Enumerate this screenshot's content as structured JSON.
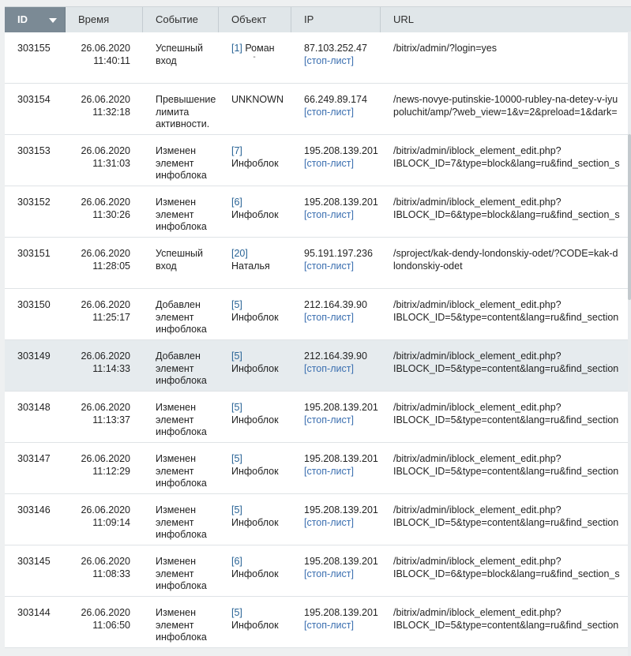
{
  "columns": {
    "id": "ID",
    "time": "Время",
    "event": "Событие",
    "object": "Объект",
    "ip": "IP",
    "url": "URL"
  },
  "sort": {
    "column": "id",
    "direction": "desc"
  },
  "stoplist_label": "[стоп-лист]",
  "rows": [
    {
      "id": "303155",
      "date": "26.06.2020",
      "time": "11:40:11",
      "event": "Успешный вход",
      "object_link": "[1]",
      "object_text": "Роман",
      "object_extra": "-",
      "ip": "87.103.252.47",
      "url1": "/bitrix/admin/?login=yes",
      "url2": ""
    },
    {
      "id": "303154",
      "date": "26.06.2020",
      "time": "11:32:18",
      "event": "Превышение лимита активности.",
      "object_link": "",
      "object_text": "UNKNOWN",
      "ip": "66.249.89.174",
      "url1": "/news-novye-putinskie-10000-rubley-na-detey-v-iyu",
      "url2": "poluchit/amp/?web_view=1&v=2&preload=1&dark="
    },
    {
      "id": "303153",
      "date": "26.06.2020",
      "time": "11:31:03",
      "event": "Изменен элемент инфоблока",
      "object_link": "[7]",
      "object_text": "Инфоблок",
      "ip": "195.208.139.201",
      "url1": "/bitrix/admin/iblock_element_edit.php?",
      "url2": "IBLOCK_ID=7&type=block&lang=ru&find_section_s"
    },
    {
      "id": "303152",
      "date": "26.06.2020",
      "time": "11:30:26",
      "event": "Изменен элемент инфоблока",
      "object_link": "[6]",
      "object_text": "Инфоблок",
      "ip": "195.208.139.201",
      "url1": "/bitrix/admin/iblock_element_edit.php?",
      "url2": "IBLOCK_ID=6&type=block&lang=ru&find_section_s"
    },
    {
      "id": "303151",
      "date": "26.06.2020",
      "time": "11:28:05",
      "event": "Успешный вход",
      "object_link": "[20]",
      "object_text": "Наталья",
      "ip": "95.191.197.236",
      "url1": "/sproject/kak-dendy-londonskiy-odet/?CODE=kak-d",
      "url2": "londonskiy-odet"
    },
    {
      "id": "303150",
      "date": "26.06.2020",
      "time": "11:25:17",
      "event": "Добавлен элемент инфоблока",
      "object_link": "[5]",
      "object_text": "Инфоблок",
      "ip": "212.164.39.90",
      "url1": "/bitrix/admin/iblock_element_edit.php?",
      "url2": "IBLOCK_ID=5&type=content&lang=ru&find_section"
    },
    {
      "id": "303149",
      "date": "26.06.2020",
      "time": "11:14:33",
      "event": "Добавлен элемент инфоблока",
      "object_link": "[5]",
      "object_text": "Инфоблок",
      "ip": "212.164.39.90",
      "url1": "/bitrix/admin/iblock_element_edit.php?",
      "url2": "IBLOCK_ID=5&type=content&lang=ru&find_section"
    },
    {
      "id": "303148",
      "date": "26.06.2020",
      "time": "11:13:37",
      "event": "Изменен элемент инфоблока",
      "object_link": "[5]",
      "object_text": "Инфоблок",
      "ip": "195.208.139.201",
      "url1": "/bitrix/admin/iblock_element_edit.php?",
      "url2": "IBLOCK_ID=5&type=content&lang=ru&find_section"
    },
    {
      "id": "303147",
      "date": "26.06.2020",
      "time": "11:12:29",
      "event": "Изменен элемент инфоблока",
      "object_link": "[5]",
      "object_text": "Инфоблок",
      "ip": "195.208.139.201",
      "url1": "/bitrix/admin/iblock_element_edit.php?",
      "url2": "IBLOCK_ID=5&type=content&lang=ru&find_section"
    },
    {
      "id": "303146",
      "date": "26.06.2020",
      "time": "11:09:14",
      "event": "Изменен элемент инфоблока",
      "object_link": "[5]",
      "object_text": "Инфоблок",
      "ip": "195.208.139.201",
      "url1": "/bitrix/admin/iblock_element_edit.php?",
      "url2": "IBLOCK_ID=5&type=content&lang=ru&find_section"
    },
    {
      "id": "303145",
      "date": "26.06.2020",
      "time": "11:08:33",
      "event": "Изменен элемент инфоблока",
      "object_link": "[6]",
      "object_text": "Инфоблок",
      "ip": "195.208.139.201",
      "url1": "/bitrix/admin/iblock_element_edit.php?",
      "url2": "IBLOCK_ID=6&type=block&lang=ru&find_section_s"
    },
    {
      "id": "303144",
      "date": "26.06.2020",
      "time": "11:06:50",
      "event": "Изменен элемент инфоблока",
      "object_link": "[5]",
      "object_text": "Инфоблок",
      "ip": "195.208.139.201",
      "url1": "/bitrix/admin/iblock_element_edit.php?",
      "url2": "IBLOCK_ID=5&type=content&lang=ru&find_section"
    }
  ],
  "highlight_row": 6,
  "colors": {
    "header_bg": "#e0e6e9",
    "sorted_header_bg": "#7b8a95",
    "row_bg": "#ffffff",
    "highlight_row_bg": "#e6ebee",
    "link": "#2a6496"
  }
}
